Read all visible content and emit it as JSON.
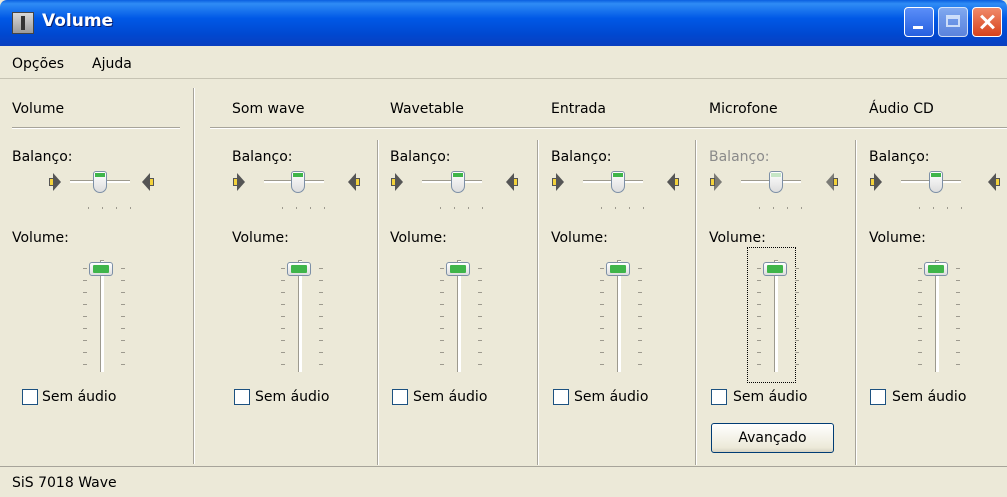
{
  "window": {
    "title": "Volume"
  },
  "menu": [
    {
      "label": "Opções"
    },
    {
      "label": "Ajuda"
    }
  ],
  "columns": [
    {
      "name": "Volume",
      "balance_label": "Balanço:",
      "volume_label": "Volume:",
      "mute_label": "Sem áudio",
      "muted": false,
      "balance_enabled": true
    },
    {
      "name": "Som wave",
      "balance_label": "Balanço:",
      "volume_label": "Volume:",
      "mute_label": "Sem áudio",
      "muted": false,
      "balance_enabled": true
    },
    {
      "name": "Wavetable",
      "balance_label": "Balanço:",
      "volume_label": "Volume:",
      "mute_label": "Sem áudio",
      "muted": false,
      "balance_enabled": true
    },
    {
      "name": "Entrada",
      "balance_label": "Balanço:",
      "volume_label": "Volume:",
      "mute_label": "Sem áudio",
      "muted": false,
      "balance_enabled": true
    },
    {
      "name": "Microfone",
      "balance_label": "Balanço:",
      "volume_label": "Volume:",
      "mute_label": "Sem áudio",
      "muted": false,
      "balance_enabled": false,
      "advanced_label": "Avançado"
    },
    {
      "name": "Áudio CD",
      "balance_label": "Balanço:",
      "volume_label": "Volume:",
      "mute_label": "Sem áudio",
      "muted": false,
      "balance_enabled": true
    }
  ],
  "status": {
    "device": "SiS 7018 Wave"
  },
  "colors": {
    "titlebar": "#0058e6",
    "face": "#ece9d8",
    "thumb_accent": "#3fb54a"
  }
}
